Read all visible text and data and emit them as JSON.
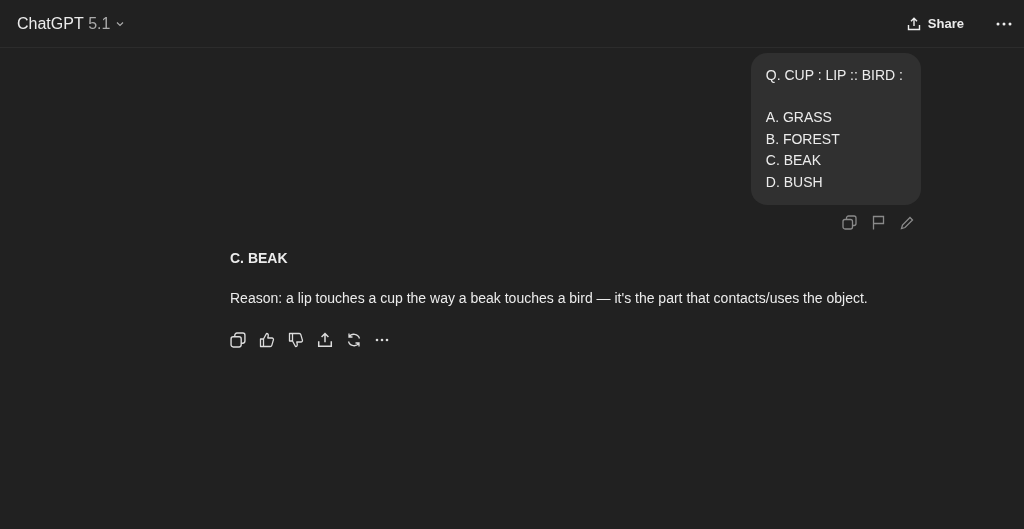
{
  "header": {
    "title": "ChatGPT",
    "model_version": "5.1",
    "share_label": "Share"
  },
  "user_message": {
    "question": "Q. CUP : LIP :: BIRD :",
    "options": [
      "A. GRASS",
      "B. FOREST",
      "C. BEAK",
      "D. BUSH"
    ]
  },
  "assistant_message": {
    "answer": "C. BEAK",
    "reason": "Reason: a lip touches a cup the way a beak touches a bird — it's the part that contacts/uses the object."
  }
}
